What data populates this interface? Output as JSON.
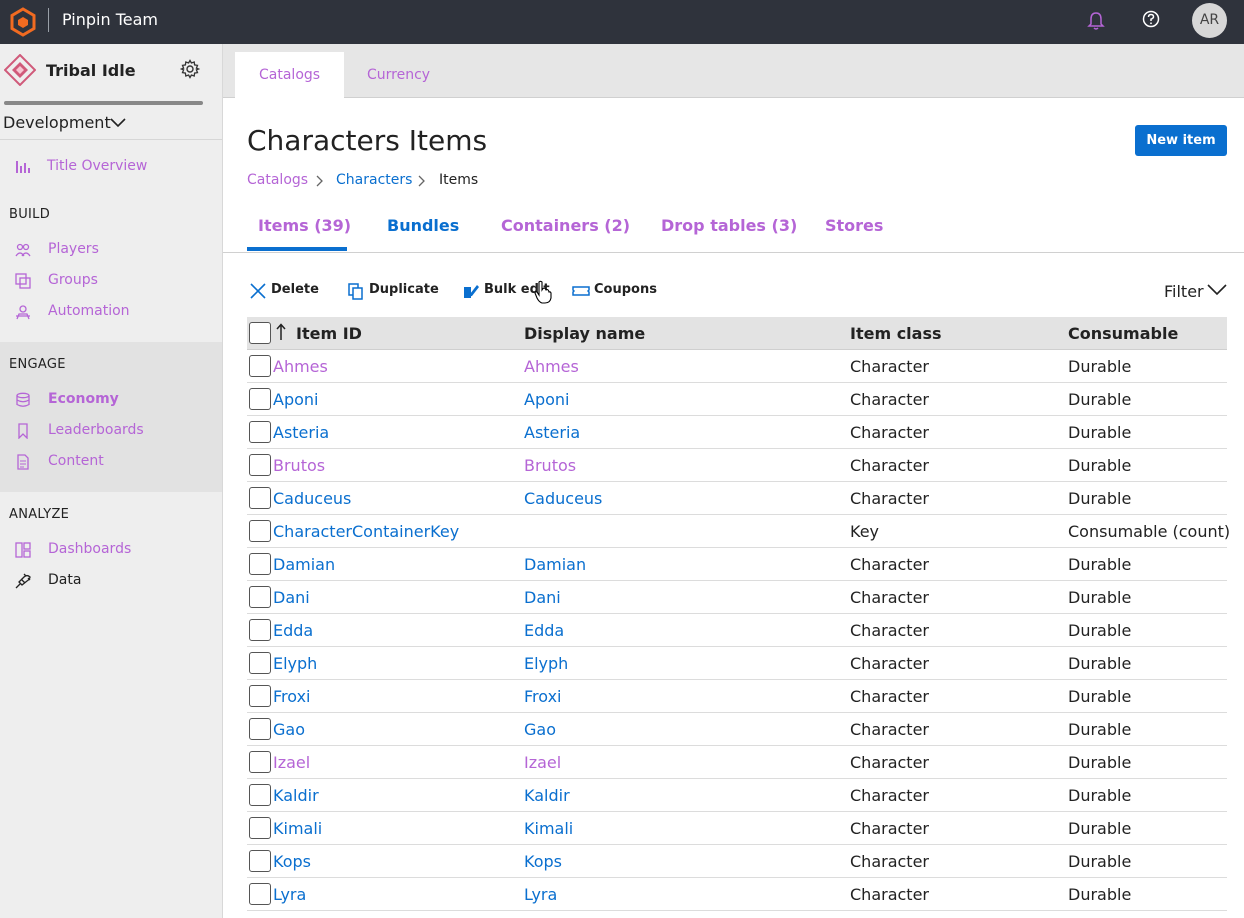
{
  "topbar": {
    "title": "Pinpin Team",
    "avatar_initials": "AR",
    "icons": [
      "logo-icon",
      "bell-icon",
      "help-icon"
    ]
  },
  "sidebar": {
    "game_title": "Tribal Idle",
    "environment": "Development",
    "items": [
      {
        "label": "Title Overview",
        "icon": "chart-icon"
      },
      {
        "label": "Players",
        "icon": "players-icon"
      },
      {
        "label": "Groups",
        "icon": "groups-icon"
      },
      {
        "label": "Automation",
        "icon": "automation-icon"
      },
      {
        "label": "Economy",
        "icon": "economy-icon"
      },
      {
        "label": "Leaderboards",
        "icon": "leaderboard-icon"
      },
      {
        "label": "Content",
        "icon": "content-icon"
      },
      {
        "label": "Dashboards",
        "icon": "dashboard-icon"
      },
      {
        "label": "Data",
        "icon": "plug-icon"
      }
    ],
    "sections": {
      "build": "BUILD",
      "engage": "ENGAGE",
      "analyze": "ANALYZE"
    }
  },
  "main": {
    "top_tabs": [
      "Catalogs",
      "Currency"
    ],
    "page_title": "Characters Items",
    "new_item_button": "New item",
    "breadcrumb": [
      "Catalogs",
      "Characters",
      "Items"
    ],
    "sub_tabs": [
      "Items (39)",
      "Bundles",
      "Containers (2)",
      "Drop tables (3)",
      "Stores"
    ],
    "toolbar": {
      "delete": "Delete",
      "duplicate": "Duplicate",
      "bulk_edit": "Bulk edit",
      "coupons": "Coupons",
      "filter": "Filter"
    },
    "table": {
      "headers": [
        "Item ID",
        "Display name",
        "Item class",
        "Consumable"
      ],
      "rows": [
        {
          "id": "Ahmes",
          "name": "Ahmes",
          "cls": "Character",
          "cons": "Durable",
          "visited": true
        },
        {
          "id": "Aponi",
          "name": "Aponi",
          "cls": "Character",
          "cons": "Durable",
          "visited": false
        },
        {
          "id": "Asteria",
          "name": "Asteria",
          "cls": "Character",
          "cons": "Durable",
          "visited": false
        },
        {
          "id": "Brutos",
          "name": "Brutos",
          "cls": "Character",
          "cons": "Durable",
          "visited": true
        },
        {
          "id": "Caduceus",
          "name": "Caduceus",
          "cls": "Character",
          "cons": "Durable",
          "visited": false
        },
        {
          "id": "CharacterContainerKey",
          "name": "",
          "cls": "Key",
          "cons": "Consumable (count)",
          "visited": false
        },
        {
          "id": "Damian",
          "name": "Damian",
          "cls": "Character",
          "cons": "Durable",
          "visited": false
        },
        {
          "id": "Dani",
          "name": "Dani",
          "cls": "Character",
          "cons": "Durable",
          "visited": false
        },
        {
          "id": "Edda",
          "name": "Edda",
          "cls": "Character",
          "cons": "Durable",
          "visited": false
        },
        {
          "id": "Elyph",
          "name": "Elyph",
          "cls": "Character",
          "cons": "Durable",
          "visited": false
        },
        {
          "id": "Froxi",
          "name": "Froxi",
          "cls": "Character",
          "cons": "Durable",
          "visited": false
        },
        {
          "id": "Gao",
          "name": "Gao",
          "cls": "Character",
          "cons": "Durable",
          "visited": false
        },
        {
          "id": "Izael",
          "name": "Izael",
          "cls": "Character",
          "cons": "Durable",
          "visited": true
        },
        {
          "id": "Kaldir",
          "name": "Kaldir",
          "cls": "Character",
          "cons": "Durable",
          "visited": false
        },
        {
          "id": "Kimali",
          "name": "Kimali",
          "cls": "Character",
          "cons": "Durable",
          "visited": false
        },
        {
          "id": "Kops",
          "name": "Kops",
          "cls": "Character",
          "cons": "Durable",
          "visited": false
        },
        {
          "id": "Lyra",
          "name": "Lyra",
          "cls": "Character",
          "cons": "Durable",
          "visited": false
        }
      ]
    }
  },
  "colors": {
    "accent": "#0a6fcf",
    "visited": "#b565d6",
    "topbar": "#2f333c"
  }
}
